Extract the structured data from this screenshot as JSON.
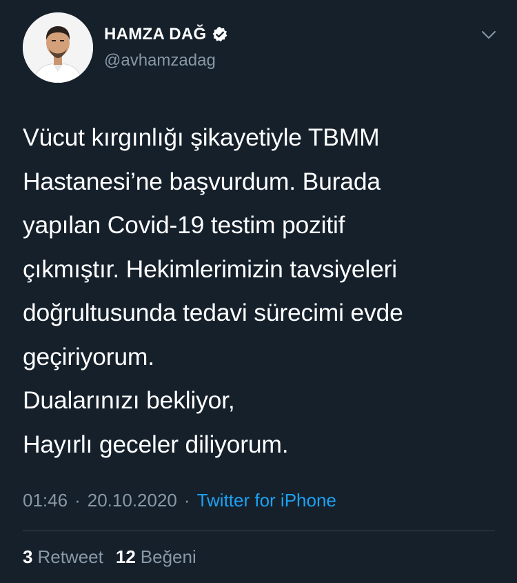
{
  "author": {
    "display_name": "HAMZA DAĞ",
    "handle": "@avhamzadag",
    "verified": true,
    "avatar_icon": "profile-photo"
  },
  "tweet": {
    "text": "Vücut kırgınlığı şikayetiyle TBMM\nHastanesi’ne başvurdum. Burada\nyapılan Covid-19 testim pozitif\nçıkmıştır. Hekimlerimizin tavsiyeleri\ndoğrultusunda tedavi sürecimi evde\ngeçiriyorum.\nDualarınızı bekliyor,\nHayırlı geceler diliyorum.",
    "time": "01:46",
    "separator": "·",
    "date": "20.10.2020",
    "source": "Twitter for iPhone"
  },
  "stats": {
    "retweets_count": "3",
    "retweets_label": "Retweet",
    "likes_count": "12",
    "likes_label": "Beğeni"
  },
  "colors": {
    "background": "#15202b",
    "primary_text": "#ffffff",
    "secondary_text": "#8899a6",
    "accent": "#1da1f2",
    "divider": "#38444d"
  },
  "icons": {
    "verified": "verified-badge-icon",
    "menu": "chevron-down-icon"
  }
}
